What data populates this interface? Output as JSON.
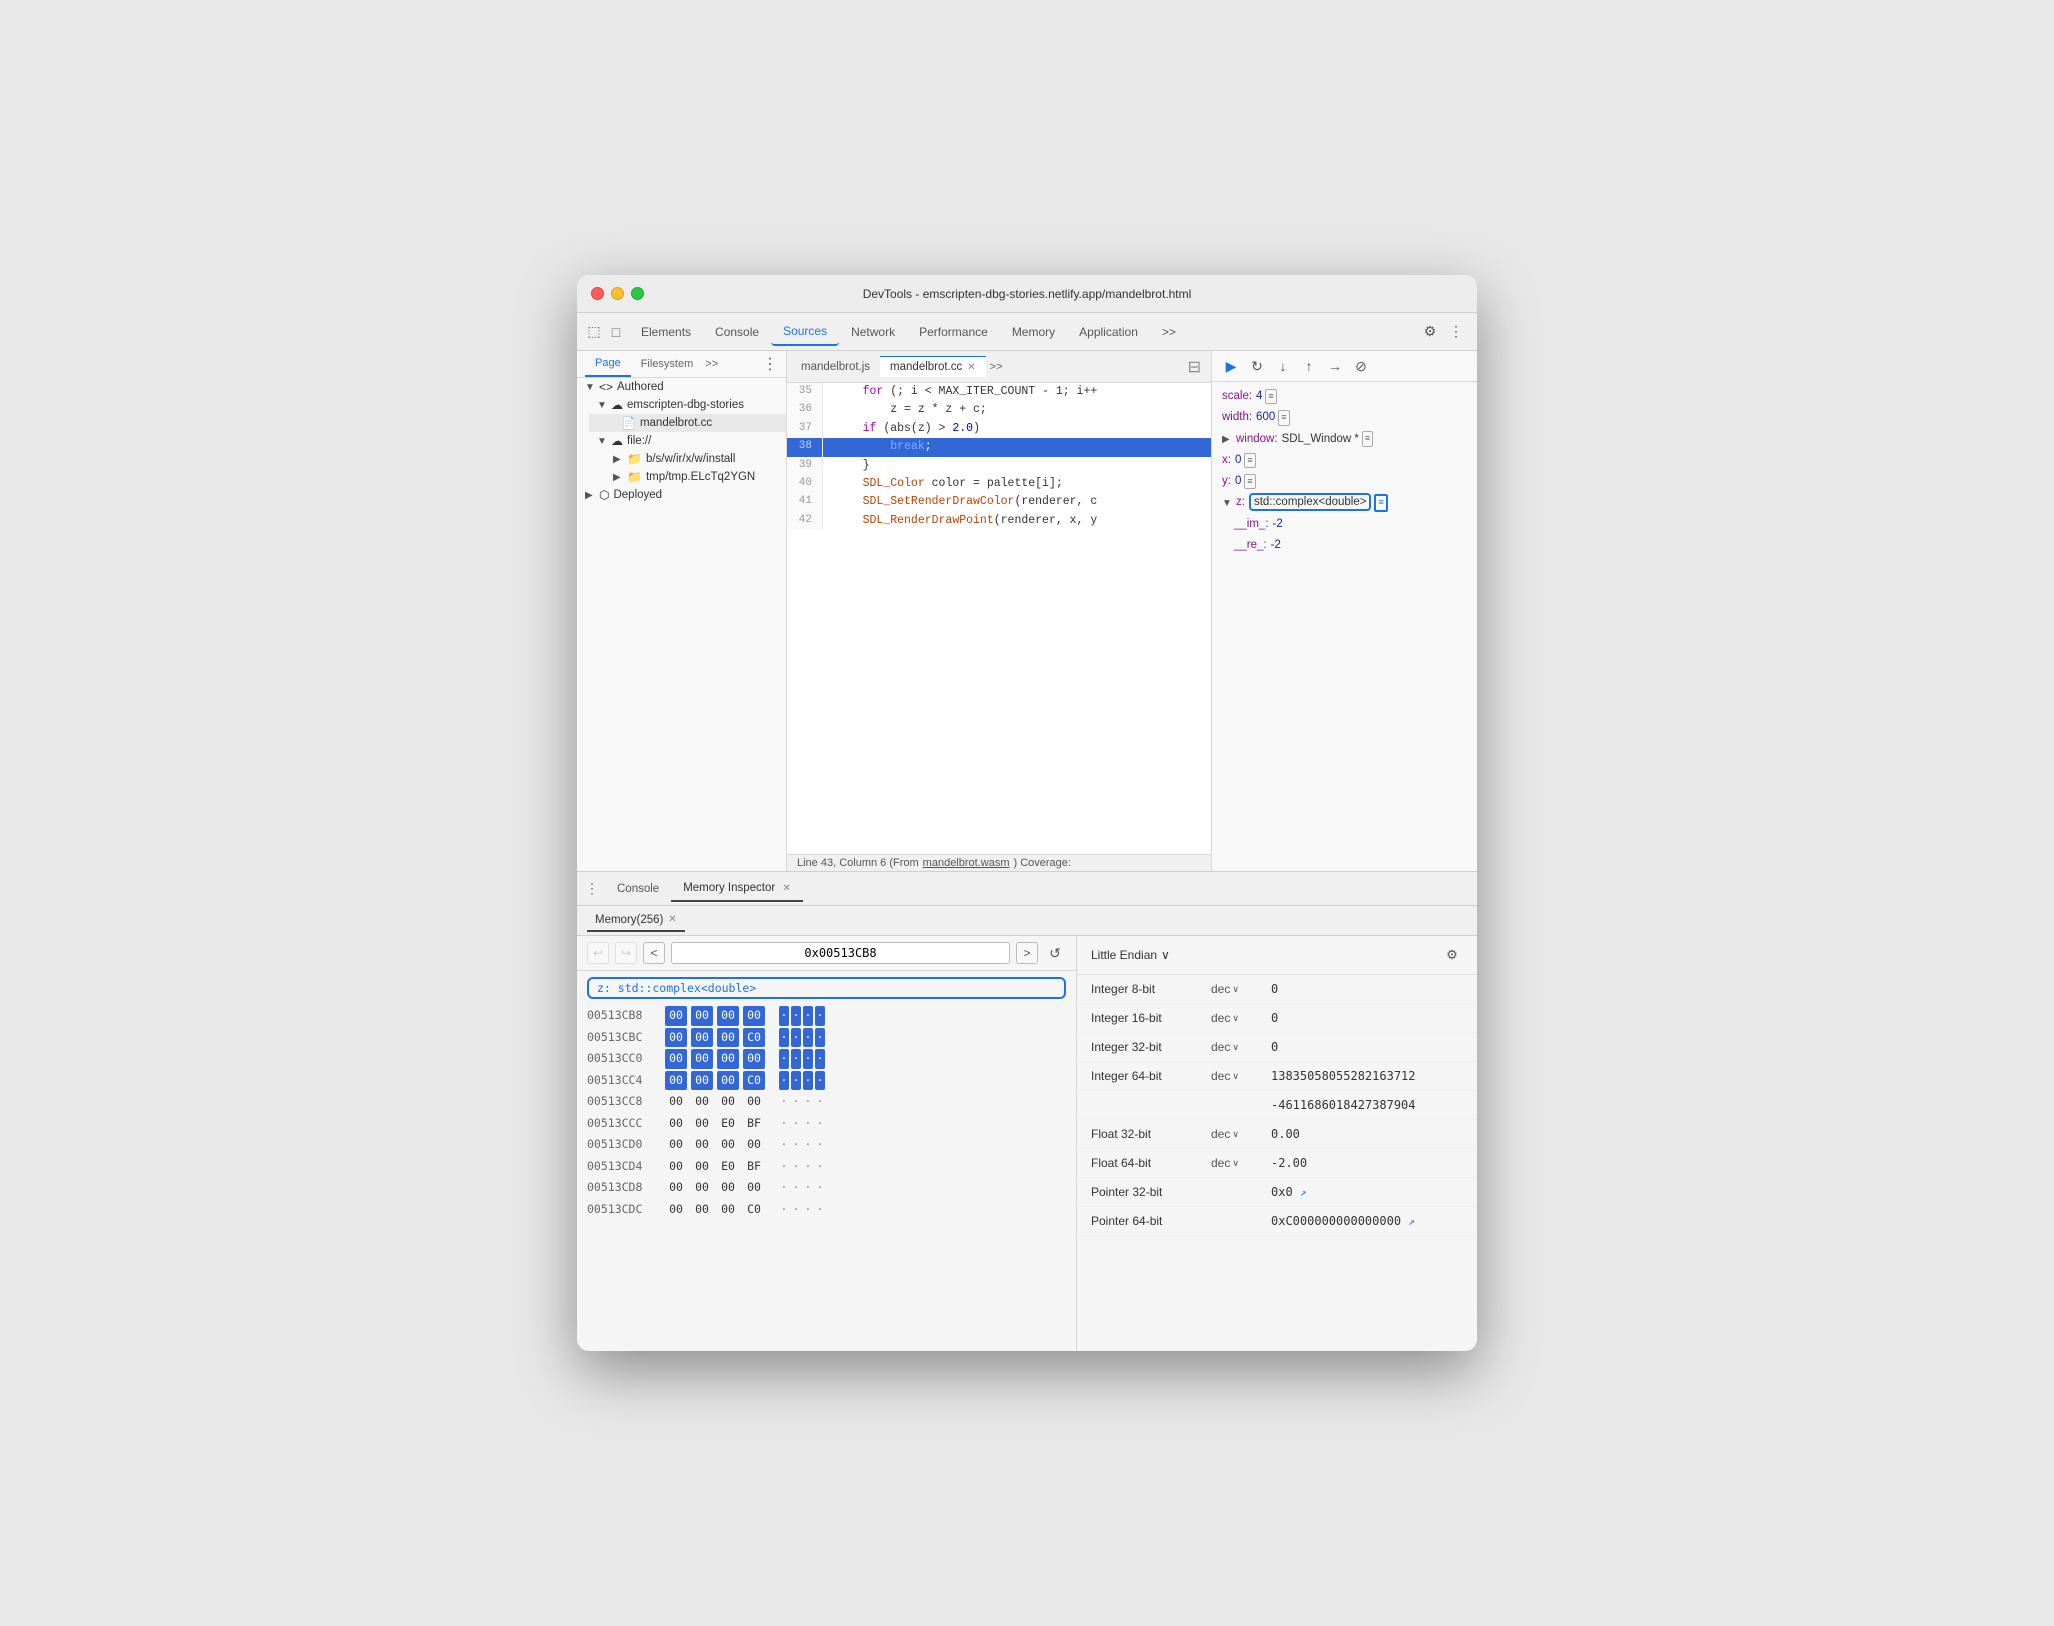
{
  "window": {
    "title": "DevTools - emscripten-dbg-stories.netlify.app/mandelbrot.html"
  },
  "tabs": {
    "items": [
      "Elements",
      "Console",
      "Sources",
      "Network",
      "Performance",
      "Memory",
      "Application"
    ],
    "active": "Sources",
    "more": ">>"
  },
  "panel_tabs": {
    "page": "Page",
    "filesystem": "Filesystem",
    "more": ">>",
    "authored": "Authored",
    "deployed": "Deployed"
  },
  "file_tree": {
    "authored_label": "Authored",
    "emscripten_label": "emscripten-dbg-stories",
    "mandelbrot_cc": "mandelbrot.cc",
    "file_label": "file://",
    "bsw_label": "b/s/w/ir/x/w/install",
    "tmp_label": "tmp/tmp.ELcTq2YGN",
    "deployed_label": "Deployed"
  },
  "editor": {
    "tabs": [
      "mandelbrot.js",
      "mandelbrot.cc"
    ],
    "active_tab": "mandelbrot.cc",
    "lines": [
      {
        "num": "35",
        "text": "    for (; i < MAX_ITER_COUNT - 1; i++ "
      },
      {
        "num": "36",
        "text": "        z = z * z + c;"
      },
      {
        "num": "37",
        "text": "    if (abs(z) > 2.0)"
      },
      {
        "num": "38",
        "text": "        break;",
        "highlighted": true
      },
      {
        "num": "39",
        "text": "    }"
      },
      {
        "num": "40",
        "text": "    SDL_Color color = palette[i];"
      },
      {
        "num": "41",
        "text": "    SDL_SetRenderDrawColor(renderer, c"
      },
      {
        "num": "42",
        "text": "    SDL_RenderDrawPoint(renderer, x, y"
      }
    ],
    "status_bar": "Line 43, Column 6 (From mandelbrot.wasm)  Coverage:"
  },
  "debug_controls": {
    "resume": "▶",
    "step_over": "↻",
    "step_into": "↓",
    "step_out": "↑",
    "step_micro": "→",
    "deactivate": "⊘"
  },
  "scope": {
    "scale_key": "scale:",
    "scale_val": "4",
    "width_key": "width:",
    "width_val": "600",
    "window_key": "window:",
    "window_val": "SDL_Window *",
    "x_key": "x:",
    "x_val": "0",
    "y_key": "y:",
    "y_val": "0",
    "z_key": "z:",
    "z_val": "std::complex<double>",
    "z_im_key": "__im_:",
    "z_im_val": "-2",
    "z_re_key": "__re_:",
    "z_re_val": "-2"
  },
  "bottom": {
    "console_tab": "Console",
    "memory_inspector_tab": "Memory Inspector",
    "memory_tab_name": "Memory(256)",
    "address_input": "0x00513CB8",
    "endian": "Little Endian",
    "badge_label": "z: std::complex<double>",
    "gear_tooltip": "Settings"
  },
  "hex_rows": [
    {
      "addr": "00513CB8",
      "bytes": [
        "00",
        "00",
        "00",
        "00"
      ],
      "highlighted": [
        true,
        true,
        true,
        true
      ],
      "ascii": [
        "·",
        "·",
        "·",
        "·"
      ],
      "ascii_hl": [
        true,
        true,
        true,
        true
      ]
    },
    {
      "addr": "00513CBC",
      "bytes": [
        "00",
        "00",
        "00",
        "C0"
      ],
      "highlighted": [
        true,
        true,
        true,
        true
      ],
      "ascii": [
        "·",
        "·",
        "·",
        "·"
      ],
      "ascii_hl": [
        true,
        true,
        true,
        true
      ]
    },
    {
      "addr": "00513CC0",
      "bytes": [
        "00",
        "00",
        "00",
        "00"
      ],
      "highlighted": [
        true,
        true,
        true,
        true
      ],
      "ascii": [
        "·",
        "·",
        "·",
        "·"
      ],
      "ascii_hl": [
        true,
        true,
        true,
        true
      ]
    },
    {
      "addr": "00513CC4",
      "bytes": [
        "00",
        "00",
        "00",
        "C0"
      ],
      "highlighted": [
        true,
        true,
        true,
        true
      ],
      "ascii": [
        "·",
        "·",
        "·",
        "·"
      ],
      "ascii_hl": [
        true,
        true,
        true,
        true
      ]
    },
    {
      "addr": "00513CC8",
      "bytes": [
        "00",
        "00",
        "00",
        "00"
      ],
      "highlighted": [
        false,
        false,
        false,
        false
      ],
      "ascii": [
        "·",
        "·",
        "·",
        "·"
      ],
      "ascii_hl": [
        false,
        false,
        false,
        false
      ]
    },
    {
      "addr": "00513CCC",
      "bytes": [
        "00",
        "00",
        "E0",
        "BF"
      ],
      "highlighted": [
        false,
        false,
        false,
        false
      ],
      "ascii": [
        "·",
        "·",
        "·",
        "·"
      ],
      "ascii_hl": [
        false,
        false,
        false,
        false
      ]
    },
    {
      "addr": "00513CD0",
      "bytes": [
        "00",
        "00",
        "00",
        "00"
      ],
      "highlighted": [
        false,
        false,
        false,
        false
      ],
      "ascii": [
        "·",
        "·",
        "·",
        "·"
      ],
      "ascii_hl": [
        false,
        false,
        false,
        false
      ]
    },
    {
      "addr": "00513CD4",
      "bytes": [
        "00",
        "00",
        "E0",
        "BF"
      ],
      "highlighted": [
        false,
        false,
        false,
        false
      ],
      "ascii": [
        "·",
        "·",
        "·",
        "·"
      ],
      "ascii_hl": [
        false,
        false,
        false,
        false
      ]
    },
    {
      "addr": "00513CD8",
      "bytes": [
        "00",
        "00",
        "00",
        "00"
      ],
      "highlighted": [
        false,
        false,
        false,
        false
      ],
      "ascii": [
        "·",
        "·",
        "·",
        "·"
      ],
      "ascii_hl": [
        false,
        false,
        false,
        false
      ]
    },
    {
      "addr": "00513CDC",
      "bytes": [
        "00",
        "00",
        "00",
        "C0"
      ],
      "highlighted": [
        false,
        false,
        false,
        false
      ],
      "ascii": [
        "·",
        "·",
        "·",
        "·"
      ],
      "ascii_hl": [
        false,
        false,
        false,
        false
      ]
    }
  ],
  "type_rows": [
    {
      "label": "Integer 8-bit",
      "format": "dec",
      "value": "0"
    },
    {
      "label": "Integer 16-bit",
      "format": "dec",
      "value": "0"
    },
    {
      "label": "Integer 32-bit",
      "format": "dec",
      "value": "0"
    },
    {
      "label": "Integer 64-bit",
      "format": "dec",
      "value": "13835058055282163712"
    },
    {
      "label": "",
      "format": "",
      "value": "-4611686018427387904"
    },
    {
      "label": "Float 32-bit",
      "format": "dec",
      "value": "0.00"
    },
    {
      "label": "Float 64-bit",
      "format": "dec",
      "value": "-2.00"
    },
    {
      "label": "Pointer 32-bit",
      "format": "",
      "value": "0x0",
      "link": true
    },
    {
      "label": "Pointer 64-bit",
      "format": "",
      "value": "0xC000000000000000",
      "link": true
    }
  ]
}
